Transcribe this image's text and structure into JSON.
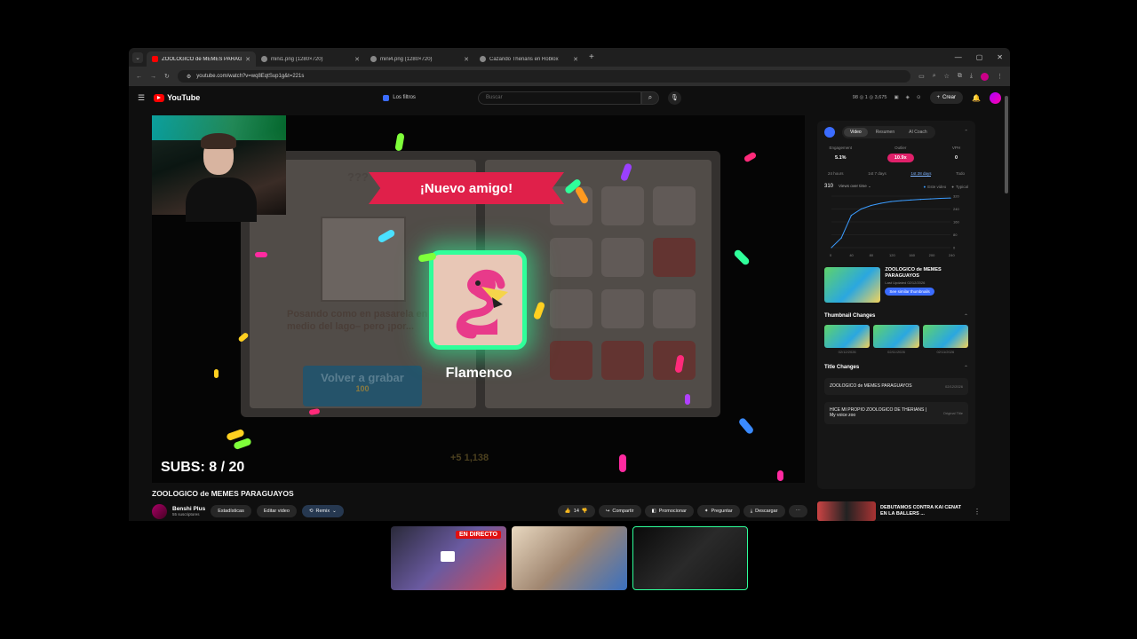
{
  "browser": {
    "tabs": [
      {
        "title": "ZOOLOGICO de MEMES PARAG...",
        "active": true,
        "favicon": "youtube"
      },
      {
        "title": "mini1.png (1280×720)",
        "active": false,
        "favicon": "globe"
      },
      {
        "title": "mini4.png (1280×720)",
        "active": false,
        "favicon": "globe"
      },
      {
        "title": "Cazando Therians en Roblox",
        "active": false,
        "favicon": "page"
      }
    ],
    "url": "youtube.com/watch?v=wq8EqtSup1g&t=221s"
  },
  "youtube": {
    "logo": "YouTube",
    "filters_chip": "Los filtros",
    "search_placeholder": "Buscar",
    "header_stats": "98 ◎ 1 ◎ 3,675",
    "create_label": "Crear"
  },
  "video": {
    "banner": "¡Nuevo amigo!",
    "animal_name": "Flamenco",
    "subs_overlay": "SUBS: 8 / 20",
    "bg_question": "???",
    "bg_description": "Posando como en pasarela en medio del lago– pero ¡por...",
    "bg_button": "Volver a grabar",
    "bg_button_cost": "100",
    "bg_coins": "+5  1,138",
    "title": "ZOOLOGICO de MEMES PARAGUAYOS"
  },
  "channel": {
    "name": "Benshi Plus",
    "subscribers": "55 suscriptores",
    "buttons": {
      "stats": "Estadísticas",
      "edit": "Editar video",
      "remix": "Remix"
    },
    "actions": {
      "likes": "14",
      "share": "Compartir",
      "promote": "Promocionar",
      "ask": "Preguntar",
      "download": "Descargar"
    }
  },
  "side_panel": {
    "tabs": [
      "Video",
      "Resumen",
      "AI Coach"
    ],
    "active_tab": "Video",
    "metrics": [
      {
        "label": "Engagement",
        "value": "5.1%"
      },
      {
        "label": "Outlier",
        "value": "10.9x"
      },
      {
        "label": "VPH",
        "value": "0"
      }
    ],
    "ranges": [
      "24 hours",
      "1st 7 days",
      "1st 28 days",
      "Todo"
    ],
    "active_range": "1st 28 days",
    "views_count": "310",
    "views_dropdown": "Views over time",
    "legend_this": "Este video",
    "legend_typical": "Typical",
    "thumbnail_title": "ZOOLOGICO de MEMES PARAGUAYOS",
    "thumbnail_updated": "Last Updated 02/12/2026",
    "see_similar": "See similar thumbnails",
    "thumbnail_changes_label": "Thumbnail Changes",
    "thumbnail_dates": [
      "02/12/2026",
      "02/11/2026",
      "02/11/2026"
    ],
    "title_changes_label": "Title Changes",
    "title_changes": [
      {
        "text": "ZOOLOGICO de MEMES PARAGUAYOS",
        "date": "02/12/2026"
      },
      {
        "text": "HICE MI PROPIO ZOOLOGICO DE THERIANS | My voice zoo",
        "date": "Original Title"
      }
    ]
  },
  "recommended": {
    "title": "DEBUTAMOS CONTRA KAI CENAT EN LA BALLERS ..."
  },
  "chart_data": {
    "type": "line",
    "x": [
      0,
      20,
      40,
      60,
      80,
      100,
      120,
      140,
      160,
      180,
      200,
      220,
      240
    ],
    "y_ticks": [
      0,
      80,
      160,
      240,
      320
    ],
    "x_ticks": [
      0,
      40,
      80,
      120,
      160,
      200,
      240
    ],
    "series": [
      {
        "name": "Este video",
        "values": [
          0,
          60,
          200,
          240,
          262,
          276,
          286,
          292,
          296,
          300,
          303,
          306,
          308
        ]
      }
    ],
    "ylim": [
      0,
      320
    ]
  },
  "tiles": {
    "live_badge": "EN DIRECTO"
  },
  "colors": {
    "accent_green": "#2fff9a",
    "banner_red": "#e0204a",
    "yt_red": "#ff0000"
  }
}
